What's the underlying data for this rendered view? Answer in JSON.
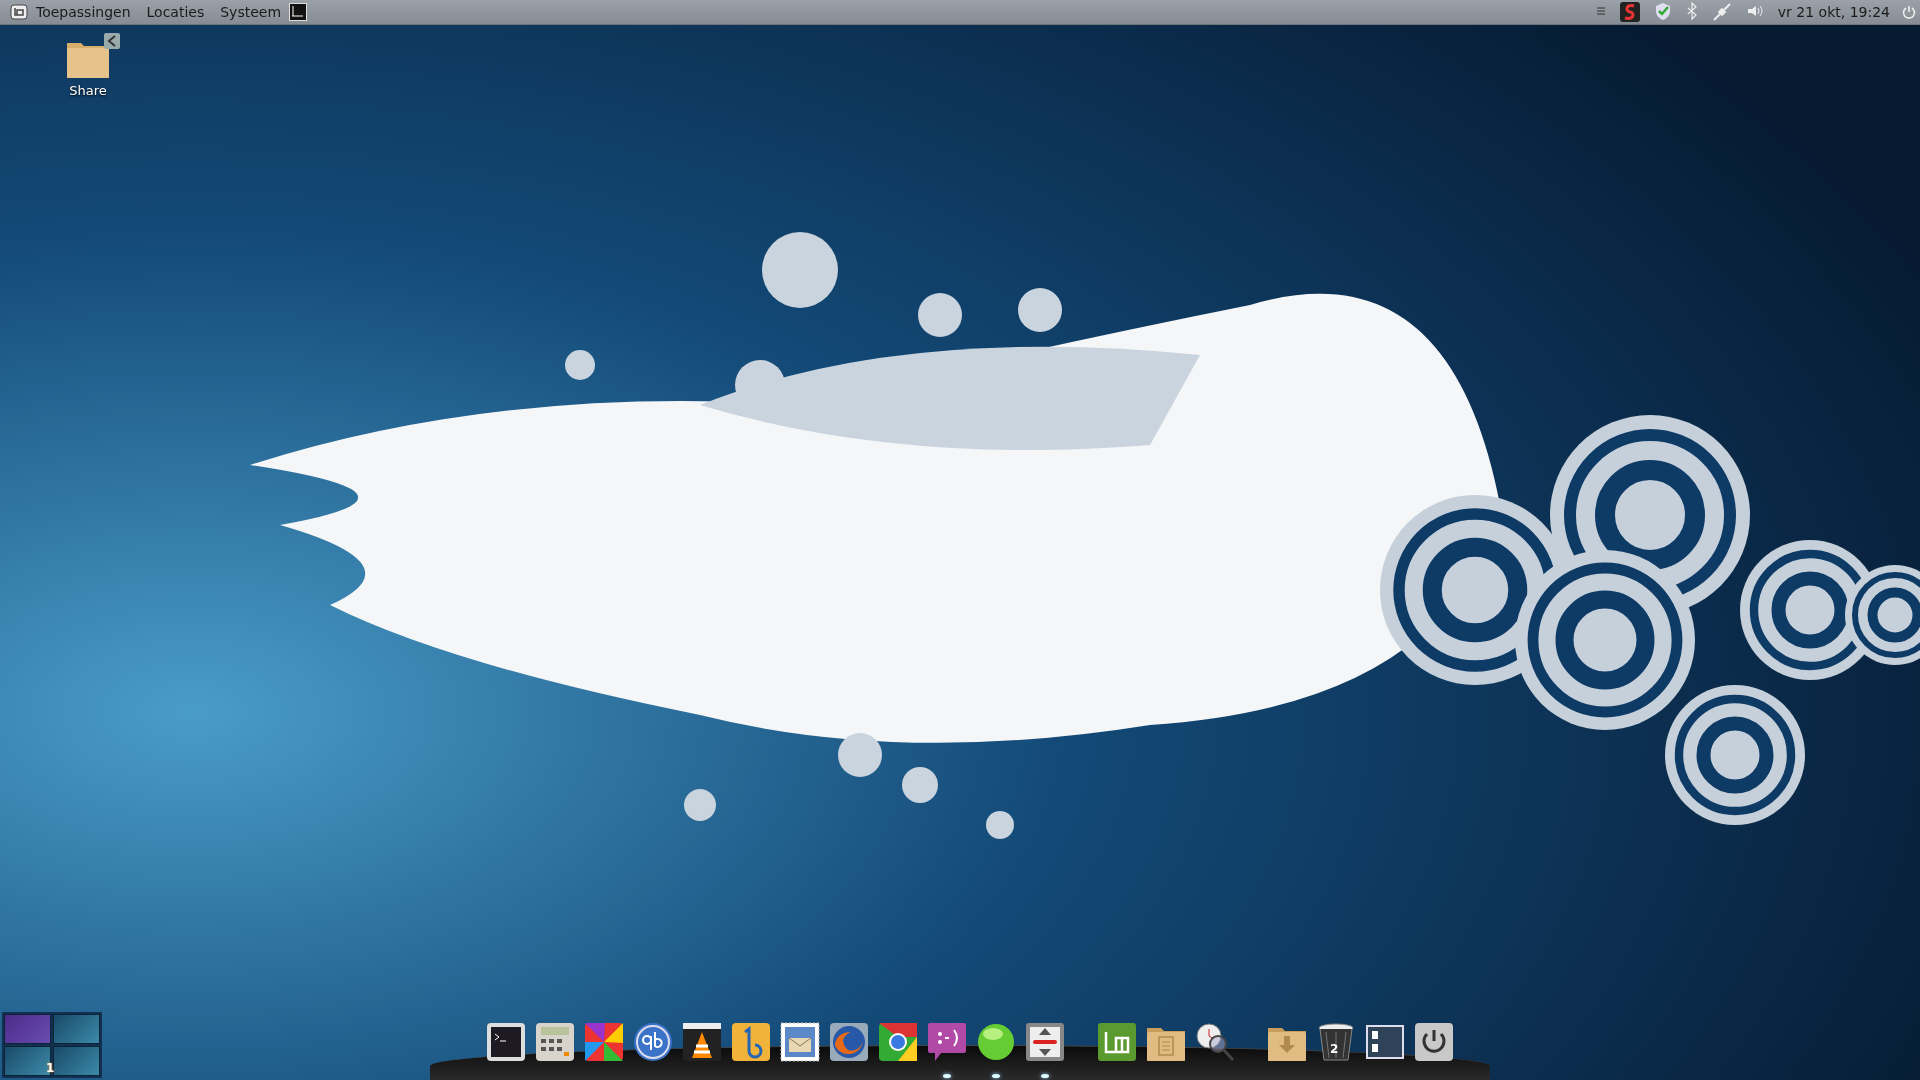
{
  "top_panel": {
    "menus": [
      {
        "label": "Toepassingen"
      },
      {
        "label": "Locaties"
      },
      {
        "label": "Systeem"
      }
    ],
    "tray": [
      {
        "kind": "menu"
      },
      {
        "kind": "app"
      },
      {
        "kind": "shield"
      },
      {
        "kind": "bluetooth"
      },
      {
        "kind": "network"
      },
      {
        "kind": "volume"
      }
    ],
    "clock": "vr 21 okt, 19:24"
  },
  "desktop_icons": [
    {
      "label": "Share",
      "shared": true
    }
  ],
  "workspaces": {
    "items": [
      {
        "selected": true
      },
      {
        "selected": false
      },
      {
        "selected": false
      },
      {
        "selected": false
      }
    ],
    "badge": "1"
  },
  "dock": {
    "items": [
      {
        "kind": "terminal",
        "running": false
      },
      {
        "kind": "calculator",
        "running": false
      },
      {
        "kind": "colorwheel",
        "running": false
      },
      {
        "kind": "qb",
        "running": false
      },
      {
        "kind": "cone",
        "running": false
      },
      {
        "kind": "bluefish",
        "running": false
      },
      {
        "kind": "mail",
        "running": false
      },
      {
        "kind": "firefox",
        "running": false
      },
      {
        "kind": "chrome",
        "running": false
      },
      {
        "kind": "chat",
        "running": true
      },
      {
        "kind": "ball",
        "running": true
      },
      {
        "kind": "arrows",
        "running": true
      },
      {
        "kind": "separator"
      },
      {
        "kind": "mint",
        "running": false
      },
      {
        "kind": "documents",
        "running": false
      },
      {
        "kind": "search",
        "running": false
      },
      {
        "kind": "separator"
      },
      {
        "kind": "downloads",
        "running": false
      },
      {
        "kind": "trash",
        "running": false,
        "badge": "2"
      },
      {
        "kind": "desktop",
        "running": false
      },
      {
        "kind": "power",
        "running": false
      }
    ]
  }
}
